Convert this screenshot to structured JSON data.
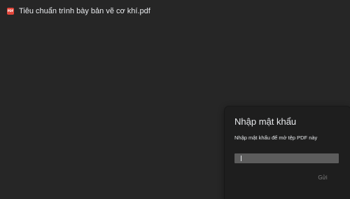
{
  "file": {
    "icon": "pdf-file-icon",
    "icon_text": "PDF",
    "title": "Tiêu chuẩn trình bày bản vẽ cơ khí.pdf"
  },
  "password_dialog": {
    "title": "Nhập mật khẩu",
    "message": "Nhập mật khẩu để mở tệp PDF này",
    "input_value": "",
    "submit_label": "Gửi"
  },
  "colors": {
    "background": "#262626",
    "dialog_background": "#1e1e1e",
    "input_background": "#5c5c5c",
    "text": "#e8eaed",
    "disabled_text": "#7f7f7f",
    "pdf_icon": "#e2463a"
  }
}
